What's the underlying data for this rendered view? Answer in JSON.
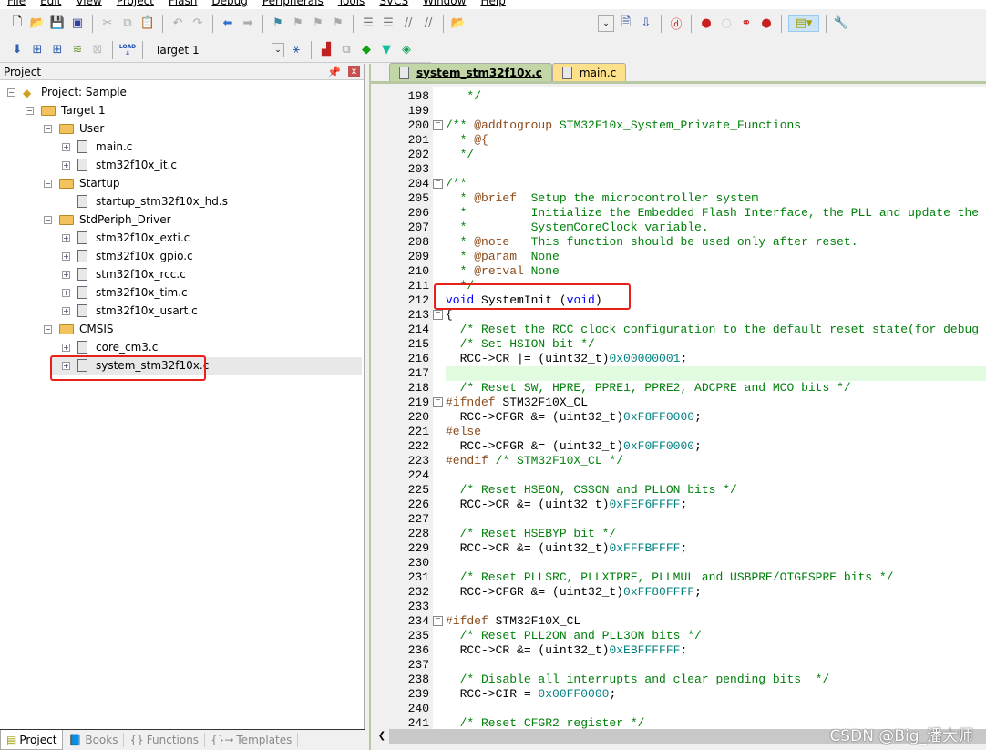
{
  "menu": [
    "File",
    "Edit",
    "View",
    "Project",
    "Flash",
    "Debug",
    "Peripherals",
    "Tools",
    "SVCS",
    "Window",
    "Help"
  ],
  "toolbar": {
    "target": "Target 1",
    "load_label": "LOAD"
  },
  "project_panel": {
    "title": "Project",
    "pin": "†",
    "close": "x",
    "tree": [
      {
        "label": "Project: Sample",
        "level": 0,
        "kind": "project",
        "exp": "-"
      },
      {
        "label": "Target 1",
        "level": 1,
        "kind": "target",
        "exp": "-"
      },
      {
        "label": "User",
        "level": 2,
        "kind": "folder",
        "exp": "-"
      },
      {
        "label": "main.c",
        "level": 3,
        "kind": "file",
        "exp": "+"
      },
      {
        "label": "stm32f10x_it.c",
        "level": 3,
        "kind": "file",
        "exp": "+"
      },
      {
        "label": "Startup",
        "level": 2,
        "kind": "folder",
        "exp": "-"
      },
      {
        "label": "startup_stm32f10x_hd.s",
        "level": 3,
        "kind": "file",
        "exp": ""
      },
      {
        "label": "StdPeriph_Driver",
        "level": 2,
        "kind": "folder",
        "exp": "-"
      },
      {
        "label": "stm32f10x_exti.c",
        "level": 3,
        "kind": "file",
        "exp": "+"
      },
      {
        "label": "stm32f10x_gpio.c",
        "level": 3,
        "kind": "file",
        "exp": "+"
      },
      {
        "label": "stm32f10x_rcc.c",
        "level": 3,
        "kind": "file",
        "exp": "+"
      },
      {
        "label": "stm32f10x_tim.c",
        "level": 3,
        "kind": "file",
        "exp": "+"
      },
      {
        "label": "stm32f10x_usart.c",
        "level": 3,
        "kind": "file",
        "exp": "+"
      },
      {
        "label": "CMSIS",
        "level": 2,
        "kind": "folder",
        "exp": "-"
      },
      {
        "label": "core_cm3.c",
        "level": 3,
        "kind": "file",
        "exp": "+"
      },
      {
        "label": "system_stm32f10x.c",
        "level": 3,
        "kind": "file",
        "exp": "+",
        "selected": true
      }
    ],
    "bottom_tabs": [
      {
        "label": "Project",
        "icon": "project-icon",
        "active": true
      },
      {
        "label": "Books",
        "icon": "books-icon"
      },
      {
        "label": "Functions",
        "icon": "{}"
      },
      {
        "label": "Templates",
        "icon": "{}→"
      }
    ]
  },
  "editor": {
    "tabs": [
      {
        "label": "system_stm32f10x.c",
        "active": true
      },
      {
        "label": "main.c",
        "active": false
      }
    ],
    "highlight_line": 217,
    "boxed_line": 212,
    "lines": [
      [
        198,
        [
          [
            "c",
            "   */"
          ]
        ]
      ],
      [
        199,
        []
      ],
      [
        200,
        [
          [
            "c",
            "/** "
          ],
          [
            "d",
            "@addtogroup"
          ],
          [
            "c",
            " STM32F10x_System_Private_Functions"
          ]
        ],
        "fold"
      ],
      [
        201,
        [
          [
            "c",
            "  * "
          ],
          [
            "d",
            "@{"
          ]
        ]
      ],
      [
        202,
        [
          [
            "c",
            "  */"
          ]
        ]
      ],
      [
        203,
        []
      ],
      [
        204,
        [
          [
            "c",
            "/**"
          ]
        ],
        "fold"
      ],
      [
        205,
        [
          [
            "c",
            "  * "
          ],
          [
            "d",
            "@brief"
          ],
          [
            "c",
            "  Setup the microcontroller system"
          ]
        ]
      ],
      [
        206,
        [
          [
            "c",
            "  *         Initialize the Embedded Flash Interface, the PLL and update the"
          ]
        ]
      ],
      [
        207,
        [
          [
            "c",
            "  *         SystemCoreClock variable."
          ]
        ]
      ],
      [
        208,
        [
          [
            "c",
            "  * "
          ],
          [
            "d",
            "@note"
          ],
          [
            "c",
            "   This function should be used only after reset."
          ]
        ]
      ],
      [
        209,
        [
          [
            "c",
            "  * "
          ],
          [
            "d",
            "@param"
          ],
          [
            "c",
            "  None"
          ]
        ]
      ],
      [
        210,
        [
          [
            "c",
            "  * "
          ],
          [
            "d",
            "@retval"
          ],
          [
            "c",
            " None"
          ]
        ]
      ],
      [
        211,
        [
          [
            "c",
            "  */"
          ]
        ]
      ],
      [
        212,
        [
          [
            "k",
            "void"
          ],
          [
            "t",
            " SystemInit ("
          ],
          [
            "k",
            "void"
          ],
          [
            "t",
            ")"
          ]
        ]
      ],
      [
        213,
        [
          [
            "t",
            "{"
          ]
        ],
        "fold"
      ],
      [
        214,
        [
          [
            "c",
            "  /* Reset the RCC clock configuration to the default reset state(for debug"
          ]
        ]
      ],
      [
        215,
        [
          [
            "c",
            "  /* Set HSION bit */"
          ]
        ]
      ],
      [
        216,
        [
          [
            "t",
            "  RCC->CR |= (uint32_t)"
          ],
          [
            "n",
            "0x00000001"
          ],
          [
            "t",
            ";"
          ]
        ]
      ],
      [
        217,
        []
      ],
      [
        218,
        [
          [
            "c",
            "  /* Reset SW, HPRE, PPRE1, PPRE2, ADCPRE and MCO bits */"
          ]
        ]
      ],
      [
        219,
        [
          [
            "p",
            "#ifndef"
          ],
          [
            "t",
            " STM32F10X_CL"
          ]
        ],
        "fold"
      ],
      [
        220,
        [
          [
            "t",
            "  RCC->CFGR &= (uint32_t)"
          ],
          [
            "n",
            "0xF8FF0000"
          ],
          [
            "t",
            ";"
          ]
        ]
      ],
      [
        221,
        [
          [
            "p",
            "#else"
          ]
        ]
      ],
      [
        222,
        [
          [
            "t",
            "  RCC->CFGR &= (uint32_t)"
          ],
          [
            "n",
            "0xF0FF0000"
          ],
          [
            "t",
            ";"
          ]
        ]
      ],
      [
        223,
        [
          [
            "p",
            "#endif"
          ],
          [
            "c",
            " /* STM32F10X_CL */"
          ]
        ]
      ],
      [
        224,
        []
      ],
      [
        225,
        [
          [
            "c",
            "  /* Reset HSEON, CSSON and PLLON bits */"
          ]
        ]
      ],
      [
        226,
        [
          [
            "t",
            "  RCC->CR &= (uint32_t)"
          ],
          [
            "n",
            "0xFEF6FFFF"
          ],
          [
            "t",
            ";"
          ]
        ]
      ],
      [
        227,
        []
      ],
      [
        228,
        [
          [
            "c",
            "  /* Reset HSEBYP bit */"
          ]
        ]
      ],
      [
        229,
        [
          [
            "t",
            "  RCC->CR &= (uint32_t)"
          ],
          [
            "n",
            "0xFFFBFFFF"
          ],
          [
            "t",
            ";"
          ]
        ]
      ],
      [
        230,
        []
      ],
      [
        231,
        [
          [
            "c",
            "  /* Reset PLLSRC, PLLXTPRE, PLLMUL and USBPRE/OTGFSPRE bits */"
          ]
        ]
      ],
      [
        232,
        [
          [
            "t",
            "  RCC->CFGR &= (uint32_t)"
          ],
          [
            "n",
            "0xFF80FFFF"
          ],
          [
            "t",
            ";"
          ]
        ]
      ],
      [
        233,
        []
      ],
      [
        234,
        [
          [
            "p",
            "#ifdef"
          ],
          [
            "t",
            " STM32F10X_CL"
          ]
        ],
        "fold"
      ],
      [
        235,
        [
          [
            "c",
            "  /* Reset PLL2ON and PLL3ON bits */"
          ]
        ]
      ],
      [
        236,
        [
          [
            "t",
            "  RCC->CR &= (uint32_t)"
          ],
          [
            "n",
            "0xEBFFFFFF"
          ],
          [
            "t",
            ";"
          ]
        ]
      ],
      [
        237,
        []
      ],
      [
        238,
        [
          [
            "c",
            "  /* Disable all interrupts and clear pending bits  */"
          ]
        ]
      ],
      [
        239,
        [
          [
            "t",
            "  RCC->CIR = "
          ],
          [
            "n",
            "0x00FF0000"
          ],
          [
            "t",
            ";"
          ]
        ]
      ],
      [
        240,
        []
      ],
      [
        241,
        [
          [
            "c",
            "  /* Reset CFGR2 register */"
          ]
        ]
      ]
    ]
  },
  "watermark": "CSDN @Big_潘大师",
  "colors": {
    "comment": "#00800a",
    "keyword": "#0000ff",
    "number": "#008080",
    "doc_tag": "#8b4a1a",
    "highlight": "#e0fbe0",
    "annotation_box": "#e8201a"
  }
}
